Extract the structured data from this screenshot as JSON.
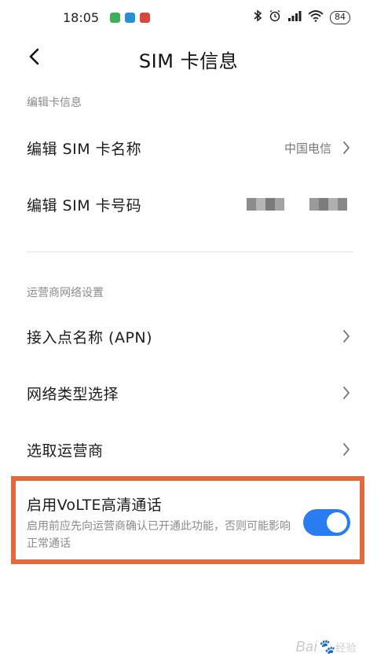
{
  "status_bar": {
    "time": "18:05",
    "battery": "84",
    "notif_colors": [
      "#3fb05a",
      "#2a8fd8",
      "#d8473a"
    ]
  },
  "header": {
    "title": "SIM 卡信息",
    "back_icon": "chevron-left-icon"
  },
  "sections": {
    "edit": {
      "label": "编辑卡信息"
    },
    "carrier": {
      "label": "运营商网络设置"
    }
  },
  "rows": {
    "sim_name": {
      "label": "编辑 SIM 卡名称",
      "value": "中国电信"
    },
    "sim_number": {
      "label": "编辑 SIM 卡号码"
    },
    "apn": {
      "label": "接入点名称 (APN)"
    },
    "network_type": {
      "label": "网络类型选择"
    },
    "operator": {
      "label": "选取运营商"
    }
  },
  "volte": {
    "title": "启用VoLTE高清通话",
    "description": "启用前应先向运营商确认已开通此功能，否则可能影响正常通话",
    "enabled": true
  },
  "watermark": {
    "text": "Bai",
    "sub": "经验"
  },
  "colors": {
    "accent": "#2a7df0",
    "highlight_border": "#e36a3c"
  }
}
